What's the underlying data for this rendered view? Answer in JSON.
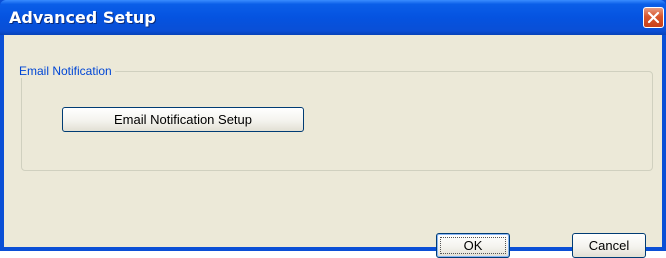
{
  "window": {
    "title": "Advanced Setup",
    "close_icon": "close-icon",
    "colors": {
      "titlebar": "#0a4fd6",
      "client": "#ece9d8",
      "group_label": "#0046d5",
      "close": "#d8562c"
    }
  },
  "group": {
    "label": "Email Notification",
    "setup_button_label": "Email Notification Setup"
  },
  "buttons": {
    "ok_label": "OK",
    "cancel_label": "Cancel"
  }
}
